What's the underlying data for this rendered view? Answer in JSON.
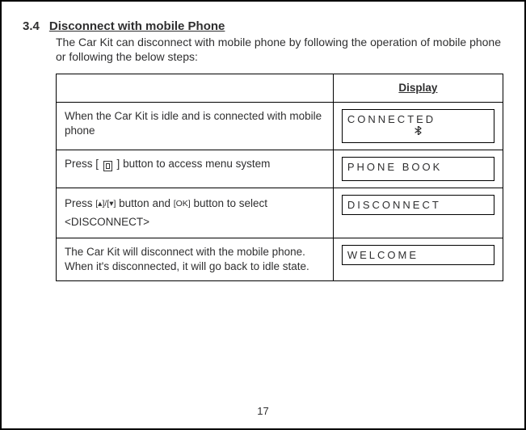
{
  "section": {
    "number": "3.4",
    "title": "Disconnect with mobile Phone",
    "intro": "The Car Kit can disconnect with mobile phone by following the operation of mobile phone or following the below steps:"
  },
  "table": {
    "display_header": "Display",
    "rows": [
      {
        "left": "When the Car Kit is idle and is connected with mobile phone",
        "lcd_line1": "CONNECTED",
        "lcd_has_bt": true
      },
      {
        "left_pre": "Press ",
        "left_post": " button to access menu system",
        "btn_kind": "menu",
        "lcd_line1": "PHONE  BOOK"
      },
      {
        "left_pre": "Press ",
        "left_mid": " button and ",
        "left_post": " button to select <DISCONNECT>",
        "btn_kind": "arrows_ok",
        "arrows_label": "[▴]/[▾]",
        "ok_label": "[OK]",
        "lcd_line1": "DISCONNECT"
      },
      {
        "left": "The Car Kit will disconnect with the mobile phone. When it's disconnected, it will go back to idle state.",
        "lcd_line1": "WELCOME"
      }
    ]
  },
  "page_number": "17",
  "bt_glyph": "฿"
}
